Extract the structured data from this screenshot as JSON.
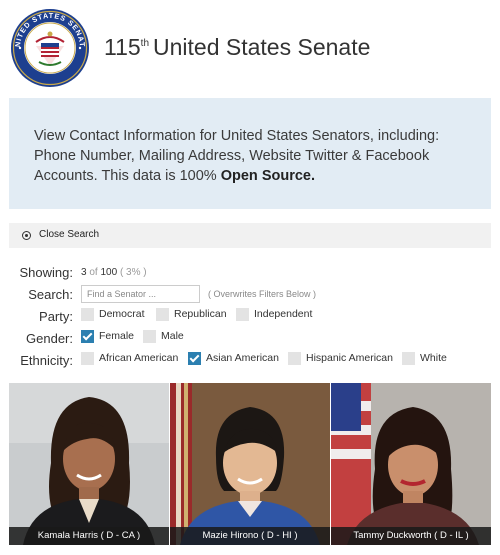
{
  "header": {
    "title_number": "115",
    "title_suffix": "th",
    "title_text": "United States Senate",
    "seal_outer_text": "UNITED STATES SENATE"
  },
  "intro": {
    "text_before": "View Contact Information for United States Senators, including: Phone Number, Mailing Address, Website Twitter & Facebook Accounts. This data is 100% ",
    "highlight": "Open Source."
  },
  "close_search": {
    "label": "Close Search",
    "icon": "radio-circle-icon"
  },
  "filters": {
    "showing": {
      "label": "Showing:",
      "count": "3",
      "of_word": "of",
      "total": "100",
      "percent": "( 3% )"
    },
    "search": {
      "label": "Search:",
      "placeholder": "Find a Senator ...",
      "note": "( Overwrites Filters Below )"
    },
    "party": {
      "label": "Party:",
      "options": [
        {
          "label": "Democrat",
          "checked": false
        },
        {
          "label": "Republican",
          "checked": false
        },
        {
          "label": "Independent",
          "checked": false
        }
      ]
    },
    "gender": {
      "label": "Gender:",
      "options": [
        {
          "label": "Female",
          "checked": true
        },
        {
          "label": "Male",
          "checked": false
        }
      ]
    },
    "ethnicity": {
      "label": "Ethnicity:",
      "options": [
        {
          "label": "African American",
          "checked": false
        },
        {
          "label": "Asian American",
          "checked": true
        },
        {
          "label": "Hispanic American",
          "checked": false
        },
        {
          "label": "White",
          "checked": false
        }
      ]
    }
  },
  "senators": [
    {
      "caption": "Kamala Harris ( D - CA )"
    },
    {
      "caption": "Mazie Hirono ( D - HI )"
    },
    {
      "caption": "Tammy Duckworth ( D - IL )"
    }
  ],
  "colors": {
    "info_bg": "#e2ecf4",
    "checkbox_checked": "#2b7fb0",
    "seal_blue": "#1d3f8f"
  }
}
